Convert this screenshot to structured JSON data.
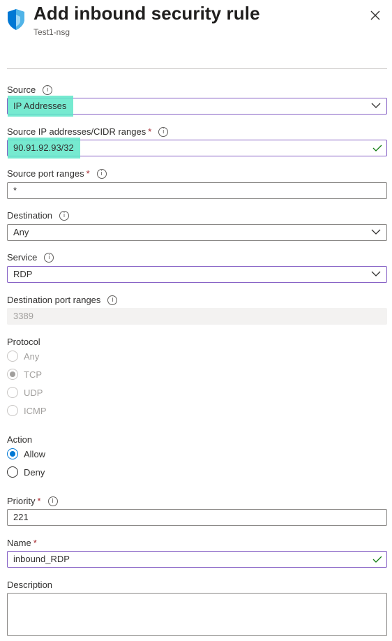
{
  "header": {
    "title": "Add inbound security rule",
    "subtitle": "Test1-nsg",
    "icon": "shield-icon",
    "close_icon": "close-icon"
  },
  "colors": {
    "accent": "#0078d4",
    "focus_border": "#8661c5",
    "highlight": "#5ee6c8",
    "required": "#a4262c",
    "valid_check": "#107c10"
  },
  "form": {
    "source": {
      "label": "Source",
      "value": "IP Addresses"
    },
    "source_ip": {
      "label": "Source IP addresses/CIDR ranges",
      "required": "*",
      "value": "90.91.92.93/32"
    },
    "source_port": {
      "label": "Source port ranges",
      "required": "*",
      "value": "*"
    },
    "destination": {
      "label": "Destination",
      "value": "Any"
    },
    "service": {
      "label": "Service",
      "value": "RDP"
    },
    "dest_port": {
      "label": "Destination port ranges",
      "value": "3389"
    },
    "protocol": {
      "label": "Protocol",
      "options": [
        "Any",
        "TCP",
        "UDP",
        "ICMP"
      ],
      "selected": "TCP"
    },
    "action": {
      "label": "Action",
      "options": [
        "Allow",
        "Deny"
      ],
      "selected": "Allow"
    },
    "priority": {
      "label": "Priority",
      "required": "*",
      "value": "221"
    },
    "name": {
      "label": "Name",
      "required": "*",
      "value": "inbound_RDP"
    },
    "description": {
      "label": "Description",
      "value": ""
    }
  }
}
